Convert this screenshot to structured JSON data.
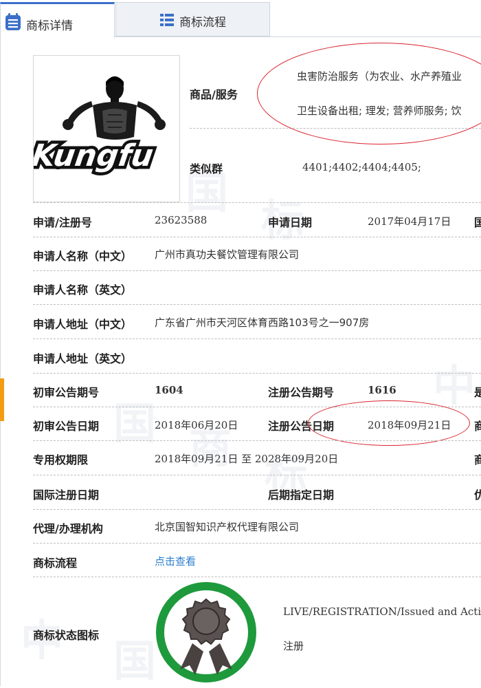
{
  "tabs": [
    {
      "label": "商标详情",
      "icon": "notebook-icon",
      "active": true
    },
    {
      "label": "商标流程",
      "icon": "list-icon",
      "active": false
    }
  ],
  "logo": {
    "text": "Kungfu",
    "alt_icon": "kungfu-fighter-logo"
  },
  "goods_services": {
    "label": "商品/服务",
    "line1": "虫害防治服务（为农业、水产养殖业",
    "line2": "卫生设备出租; 理发; 营养师服务; 饮"
  },
  "similar_group": {
    "label": "类似群",
    "value": "4401;4402;4404;4405;"
  },
  "rows": {
    "reg_no": {
      "label": "申请/注册号",
      "value": "23623588"
    },
    "app_date": {
      "label": "申请日期",
      "value": "2017年04月17日",
      "edge": "国"
    },
    "name_cn": {
      "label": "申请人名称（中文）",
      "value": "广州市真功夫餐饮管理有限公司"
    },
    "name_en": {
      "label": "申请人名称（英文）",
      "value": ""
    },
    "addr_cn": {
      "label": "申请人地址（中文）",
      "value": "广东省广州市天河区体育西路103号之一907房"
    },
    "addr_en": {
      "label": "申请人地址（英文）",
      "value": ""
    },
    "prelim_no": {
      "label": "初审公告期号",
      "value": "1604"
    },
    "reg_pub_no": {
      "label": "注册公告期号",
      "value": "1616",
      "edge": "是"
    },
    "prelim_date": {
      "label": "初审公告日期",
      "value": "2018年06月20日"
    },
    "reg_pub_date": {
      "label": "注册公告日期",
      "value": "2018年09月21日",
      "edge": "商"
    },
    "exclusive": {
      "label": "专用权期限",
      "value": "2018年09月21日 至 2028年09月20日",
      "edge": "商"
    },
    "intl_reg": {
      "label": "国际注册日期",
      "value": ""
    },
    "later_date": {
      "label": "后期指定日期",
      "value": "",
      "edge": "优"
    },
    "agent": {
      "label": "代理/办理机构",
      "value": "北京国智知识产权代理有限公司"
    },
    "flow": {
      "label": "商标流程",
      "value": "点击查看"
    },
    "status": {
      "label": "商标状态图标",
      "line1": "LIVE/REGISTRATION/Issued and Activ",
      "line2": "注册"
    }
  },
  "colors": {
    "accent": "#3b6fc9",
    "link": "#2a7ecf",
    "annotation": "#d9232d",
    "badge_ring": "#1e9a3c",
    "badge_medal": "#5a5250"
  },
  "watermark": [
    "中",
    "国",
    "商",
    "标",
    "网"
  ]
}
